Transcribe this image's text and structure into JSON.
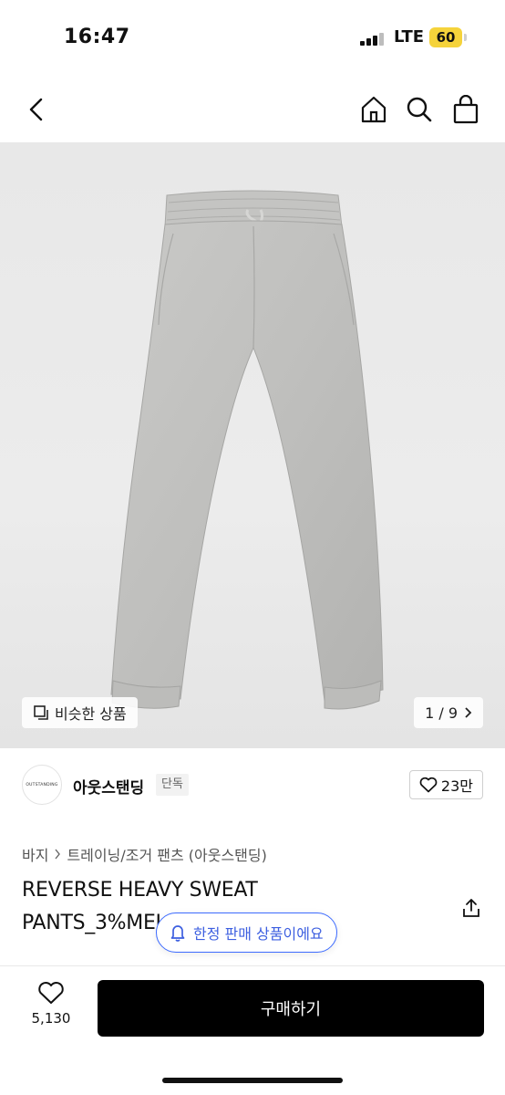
{
  "status_bar": {
    "time": "16:47",
    "network": "LTE",
    "battery": "60"
  },
  "nav": {
    "back_icon": "chevron-left-icon",
    "home_icon": "home-icon",
    "search_icon": "search-icon",
    "cart_icon": "shopping-bag-icon"
  },
  "gallery": {
    "similar_label": "비슷한 상품",
    "page_indicator": "1 / 9"
  },
  "brand": {
    "logo_text": "OUTSTANDING",
    "name": "아웃스탠딩",
    "badge": "단독",
    "like_count": "23만"
  },
  "product": {
    "breadcrumb": [
      "바지",
      "트레이닝/조거 팬츠 (아웃스탠딩)"
    ],
    "title": "REVERSE HEAVY SWEAT PANTS_3%MELANGE GRAY",
    "limited_notice": "한정 판매 상품이에요"
  },
  "bottom_bar": {
    "like_count": "5,130",
    "buy_label": "구매하기"
  },
  "colors": {
    "accent_blue": "#3d5fe0",
    "battery_yellow": "#f5d33b",
    "buy_button": "#000000"
  }
}
